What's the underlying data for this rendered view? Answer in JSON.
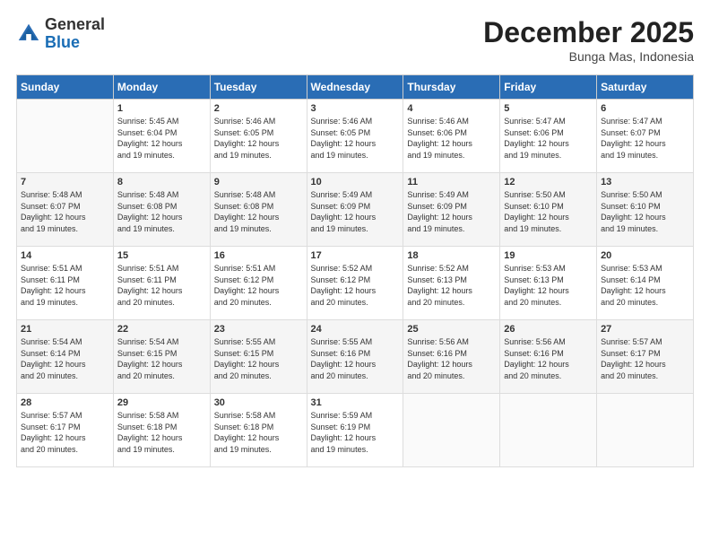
{
  "header": {
    "logo_general": "General",
    "logo_blue": "Blue",
    "month_title": "December 2025",
    "location": "Bunga Mas, Indonesia"
  },
  "days_of_week": [
    "Sunday",
    "Monday",
    "Tuesday",
    "Wednesday",
    "Thursday",
    "Friday",
    "Saturday"
  ],
  "weeks": [
    [
      {
        "day": "",
        "sunrise": "",
        "sunset": "",
        "daylight": ""
      },
      {
        "day": "1",
        "sunrise": "5:45 AM",
        "sunset": "6:04 PM",
        "daylight": "12 hours and 19 minutes."
      },
      {
        "day": "2",
        "sunrise": "5:46 AM",
        "sunset": "6:05 PM",
        "daylight": "12 hours and 19 minutes."
      },
      {
        "day": "3",
        "sunrise": "5:46 AM",
        "sunset": "6:05 PM",
        "daylight": "12 hours and 19 minutes."
      },
      {
        "day": "4",
        "sunrise": "5:46 AM",
        "sunset": "6:06 PM",
        "daylight": "12 hours and 19 minutes."
      },
      {
        "day": "5",
        "sunrise": "5:47 AM",
        "sunset": "6:06 PM",
        "daylight": "12 hours and 19 minutes."
      },
      {
        "day": "6",
        "sunrise": "5:47 AM",
        "sunset": "6:07 PM",
        "daylight": "12 hours and 19 minutes."
      }
    ],
    [
      {
        "day": "7",
        "sunrise": "5:48 AM",
        "sunset": "6:07 PM",
        "daylight": "12 hours and 19 minutes."
      },
      {
        "day": "8",
        "sunrise": "5:48 AM",
        "sunset": "6:08 PM",
        "daylight": "12 hours and 19 minutes."
      },
      {
        "day": "9",
        "sunrise": "5:48 AM",
        "sunset": "6:08 PM",
        "daylight": "12 hours and 19 minutes."
      },
      {
        "day": "10",
        "sunrise": "5:49 AM",
        "sunset": "6:09 PM",
        "daylight": "12 hours and 19 minutes."
      },
      {
        "day": "11",
        "sunrise": "5:49 AM",
        "sunset": "6:09 PM",
        "daylight": "12 hours and 19 minutes."
      },
      {
        "day": "12",
        "sunrise": "5:50 AM",
        "sunset": "6:10 PM",
        "daylight": "12 hours and 19 minutes."
      },
      {
        "day": "13",
        "sunrise": "5:50 AM",
        "sunset": "6:10 PM",
        "daylight": "12 hours and 19 minutes."
      }
    ],
    [
      {
        "day": "14",
        "sunrise": "5:51 AM",
        "sunset": "6:11 PM",
        "daylight": "12 hours and 19 minutes."
      },
      {
        "day": "15",
        "sunrise": "5:51 AM",
        "sunset": "6:11 PM",
        "daylight": "12 hours and 20 minutes."
      },
      {
        "day": "16",
        "sunrise": "5:51 AM",
        "sunset": "6:12 PM",
        "daylight": "12 hours and 20 minutes."
      },
      {
        "day": "17",
        "sunrise": "5:52 AM",
        "sunset": "6:12 PM",
        "daylight": "12 hours and 20 minutes."
      },
      {
        "day": "18",
        "sunrise": "5:52 AM",
        "sunset": "6:13 PM",
        "daylight": "12 hours and 20 minutes."
      },
      {
        "day": "19",
        "sunrise": "5:53 AM",
        "sunset": "6:13 PM",
        "daylight": "12 hours and 20 minutes."
      },
      {
        "day": "20",
        "sunrise": "5:53 AM",
        "sunset": "6:14 PM",
        "daylight": "12 hours and 20 minutes."
      }
    ],
    [
      {
        "day": "21",
        "sunrise": "5:54 AM",
        "sunset": "6:14 PM",
        "daylight": "12 hours and 20 minutes."
      },
      {
        "day": "22",
        "sunrise": "5:54 AM",
        "sunset": "6:15 PM",
        "daylight": "12 hours and 20 minutes."
      },
      {
        "day": "23",
        "sunrise": "5:55 AM",
        "sunset": "6:15 PM",
        "daylight": "12 hours and 20 minutes."
      },
      {
        "day": "24",
        "sunrise": "5:55 AM",
        "sunset": "6:16 PM",
        "daylight": "12 hours and 20 minutes."
      },
      {
        "day": "25",
        "sunrise": "5:56 AM",
        "sunset": "6:16 PM",
        "daylight": "12 hours and 20 minutes."
      },
      {
        "day": "26",
        "sunrise": "5:56 AM",
        "sunset": "6:16 PM",
        "daylight": "12 hours and 20 minutes."
      },
      {
        "day": "27",
        "sunrise": "5:57 AM",
        "sunset": "6:17 PM",
        "daylight": "12 hours and 20 minutes."
      }
    ],
    [
      {
        "day": "28",
        "sunrise": "5:57 AM",
        "sunset": "6:17 PM",
        "daylight": "12 hours and 20 minutes."
      },
      {
        "day": "29",
        "sunrise": "5:58 AM",
        "sunset": "6:18 PM",
        "daylight": "12 hours and 19 minutes."
      },
      {
        "day": "30",
        "sunrise": "5:58 AM",
        "sunset": "6:18 PM",
        "daylight": "12 hours and 19 minutes."
      },
      {
        "day": "31",
        "sunrise": "5:59 AM",
        "sunset": "6:19 PM",
        "daylight": "12 hours and 19 minutes."
      },
      {
        "day": "",
        "sunrise": "",
        "sunset": "",
        "daylight": ""
      },
      {
        "day": "",
        "sunrise": "",
        "sunset": "",
        "daylight": ""
      },
      {
        "day": "",
        "sunrise": "",
        "sunset": "",
        "daylight": ""
      }
    ]
  ]
}
